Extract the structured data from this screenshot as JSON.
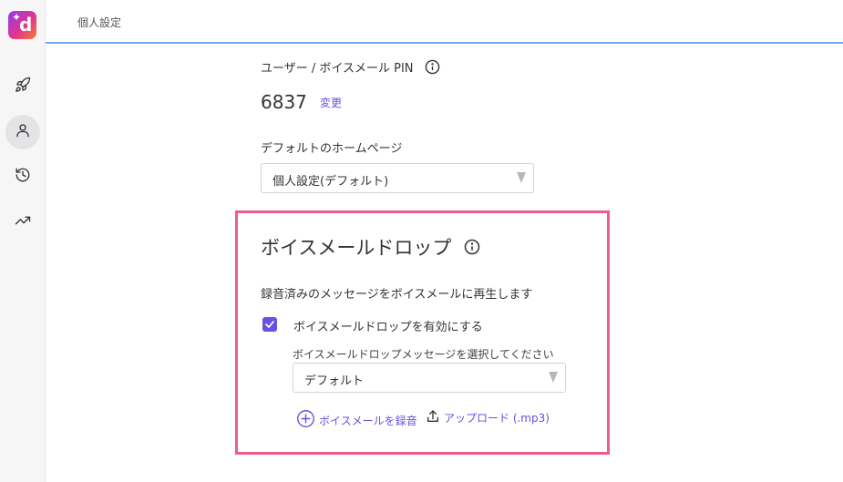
{
  "header": {
    "title": "個人設定"
  },
  "sidebar": {
    "logo_letter": "d",
    "items": [
      {
        "icon": "rocket-icon",
        "active": false
      },
      {
        "icon": "user-icon",
        "active": true
      },
      {
        "icon": "history-icon",
        "active": false
      },
      {
        "icon": "trending-up-icon",
        "active": false
      }
    ]
  },
  "pin": {
    "label": "ユーザー / ボイスメール PIN",
    "value": "6837",
    "change_label": "変更"
  },
  "homepage": {
    "label": "デフォルトのホームページ",
    "selected": "個人設定(デフォルト)"
  },
  "voicemail_drop": {
    "title": "ボイスメールドロップ",
    "description": "録音済みのメッセージをボイスメールに再生します",
    "enable_label": "ボイスメールドロップを有効にする",
    "enabled": true,
    "message_label": "ボイスメールドロップメッセージを選択してください",
    "message_selected": "デフォルト",
    "record_label": "ボイスメールを録音",
    "upload_label": "アップロード (.mp3)"
  },
  "colors": {
    "accent": "#6b4fe0",
    "highlight_border": "#ec5c8d",
    "header_underline": "#6fa9e8"
  }
}
